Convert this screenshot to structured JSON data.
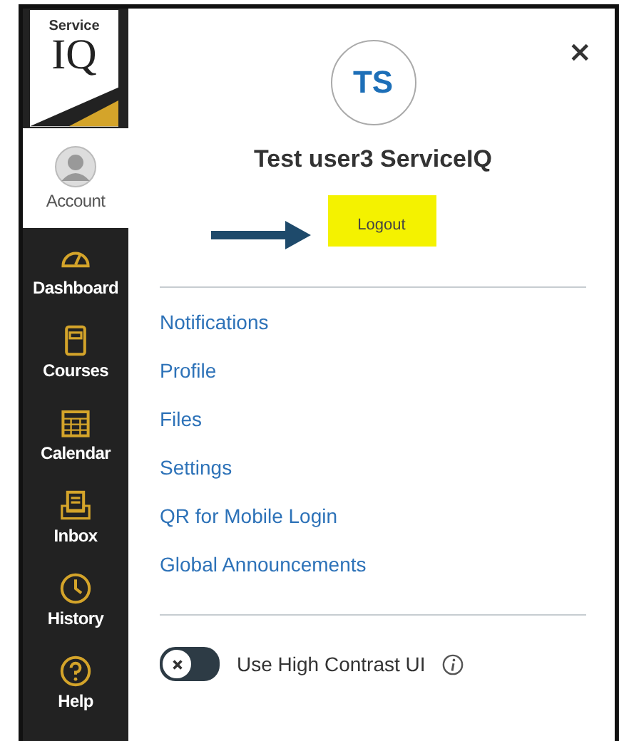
{
  "logo": {
    "small": "Service",
    "big": "IQ"
  },
  "sidebar": {
    "items": [
      {
        "kind": "account",
        "label": "Account",
        "selected": true
      },
      {
        "kind": "dashboard",
        "label": "Dashboard",
        "selected": false
      },
      {
        "kind": "courses",
        "label": "Courses",
        "selected": false
      },
      {
        "kind": "calendar",
        "label": "Calendar",
        "selected": false
      },
      {
        "kind": "inbox",
        "label": "Inbox",
        "selected": false
      },
      {
        "kind": "history",
        "label": "History",
        "selected": false
      },
      {
        "kind": "help",
        "label": "Help",
        "selected": false
      }
    ]
  },
  "tray": {
    "close": "×",
    "avatar": "TS",
    "name": "Test user3 ServiceIQ",
    "logout": "Logout",
    "links": [
      "Notifications",
      "Profile",
      "Files",
      "Settings",
      "QR for Mobile Login",
      "Global Announcements"
    ],
    "toggle": {
      "label": "Use High Contrast UI",
      "checked": false
    }
  }
}
